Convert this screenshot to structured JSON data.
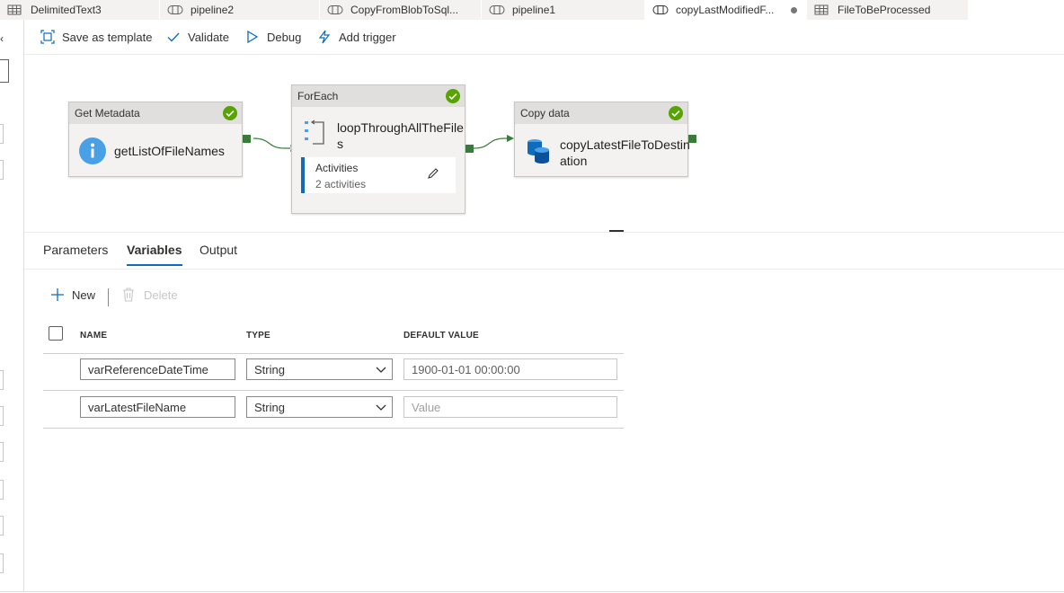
{
  "tabs": [
    {
      "label": "DelimitedText3",
      "icon": "table-icon",
      "active": false
    },
    {
      "label": "pipeline2",
      "icon": "pipeline-icon",
      "active": false
    },
    {
      "label": "CopyFromBlobToSql...",
      "icon": "pipeline-icon",
      "active": false
    },
    {
      "label": "pipeline1",
      "icon": "pipeline-icon",
      "active": false
    },
    {
      "label": "copyLastModifiedF...",
      "icon": "pipeline-icon",
      "active": true,
      "unsaved": true
    },
    {
      "label": "FileToBeProcessed",
      "icon": "table-icon",
      "active": false
    }
  ],
  "toolbar": {
    "save_as_template": "Save as template",
    "validate": "Validate",
    "debug": "Debug",
    "add_trigger": "Add trigger"
  },
  "activities": {
    "get_metadata": {
      "type": "Get Metadata",
      "name": "getListOfFileNames",
      "status": "succeeded"
    },
    "foreach": {
      "type": "ForEach",
      "name_line1": "loopThroughAllTheFile",
      "name_line2": "s",
      "activities_label": "Activities",
      "activities_count": "2 activities",
      "status": "succeeded"
    },
    "copy_data": {
      "type": "Copy data",
      "name_line1": "copyLatestFileToDestin",
      "name_line2": "ation",
      "status": "succeeded"
    }
  },
  "panel": {
    "tabs": [
      "Parameters",
      "Variables",
      "Output"
    ],
    "active_tab": "Variables",
    "new_label": "New",
    "delete_label": "Delete",
    "columns": {
      "name": "NAME",
      "type": "TYPE",
      "default": "DEFAULT VALUE"
    },
    "rows": [
      {
        "name": "varReferenceDateTime",
        "type": "String",
        "default": "1900-01-01 00:00:00"
      },
      {
        "name": "varLatestFileName",
        "type": "String",
        "default": "",
        "placeholder": "Value"
      }
    ]
  },
  "colors": {
    "accent": "#0f6cbd",
    "success": "#57a300",
    "port": "#3a7a3a"
  }
}
